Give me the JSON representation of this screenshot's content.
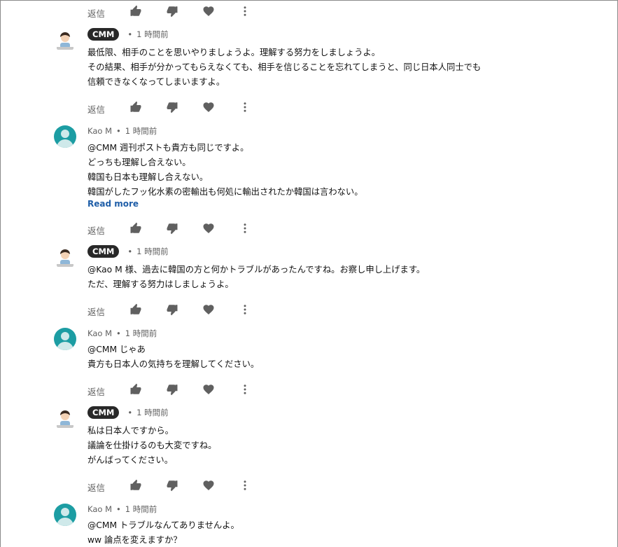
{
  "labels": {
    "reply": "返信",
    "read_more": "Read more"
  },
  "icons": {
    "like": "thumbs-up-icon",
    "dislike": "thumbs-down-icon",
    "heart": "heart-icon",
    "more": "more-vert-icon"
  },
  "colors": {
    "badge_bg": "#282828",
    "avatar_teal": "#1c9da3",
    "link": "#1f5ea8",
    "meta": "#606060"
  },
  "comments": [
    {
      "author": "CMM",
      "time": "1 時間前",
      "lines": [
        "最低限、相手のことを思いやりましょうよ。理解する努力をしましょうよ。",
        "その結果、相手が分かってもらえなくても、相手を信じることを忘れてしまうと、同じ日本人同士でも",
        "信頼できなくなってしまいますよ。"
      ]
    },
    {
      "author": "Kao M",
      "time": "1 時間前",
      "lines": [
        "@CMM 週刊ポストも貴方も同じですよ。",
        "どっちも理解し合えない。",
        "韓国も日本も理解し合えない。",
        "韓国がしたフッ化水素の密輸出も何処に輸出されたか韓国は言わない。"
      ]
    },
    {
      "author": "CMM",
      "time": "1 時間前",
      "lines": [
        "@Kao M 様、過去に韓国の方と何かトラブルがあったんですね。お察し申し上げます。",
        "ただ、理解する努力はしましょうよ。"
      ]
    },
    {
      "author": "Kao M",
      "time": "1 時間前",
      "lines": [
        "@CMM じゃあ",
        "貴方も日本人の気持ちを理解してください。"
      ]
    },
    {
      "author": "CMM",
      "time": "1 時間前",
      "lines": [
        "私は日本人ですから。",
        "議論を仕掛けるのも大変ですね。",
        "がんばってください。"
      ]
    },
    {
      "author": "Kao M",
      "time": "1 時間前",
      "lines": [
        "@CMM トラブルなんてありませんよ。",
        "ww 論点を変えますか？"
      ]
    }
  ]
}
